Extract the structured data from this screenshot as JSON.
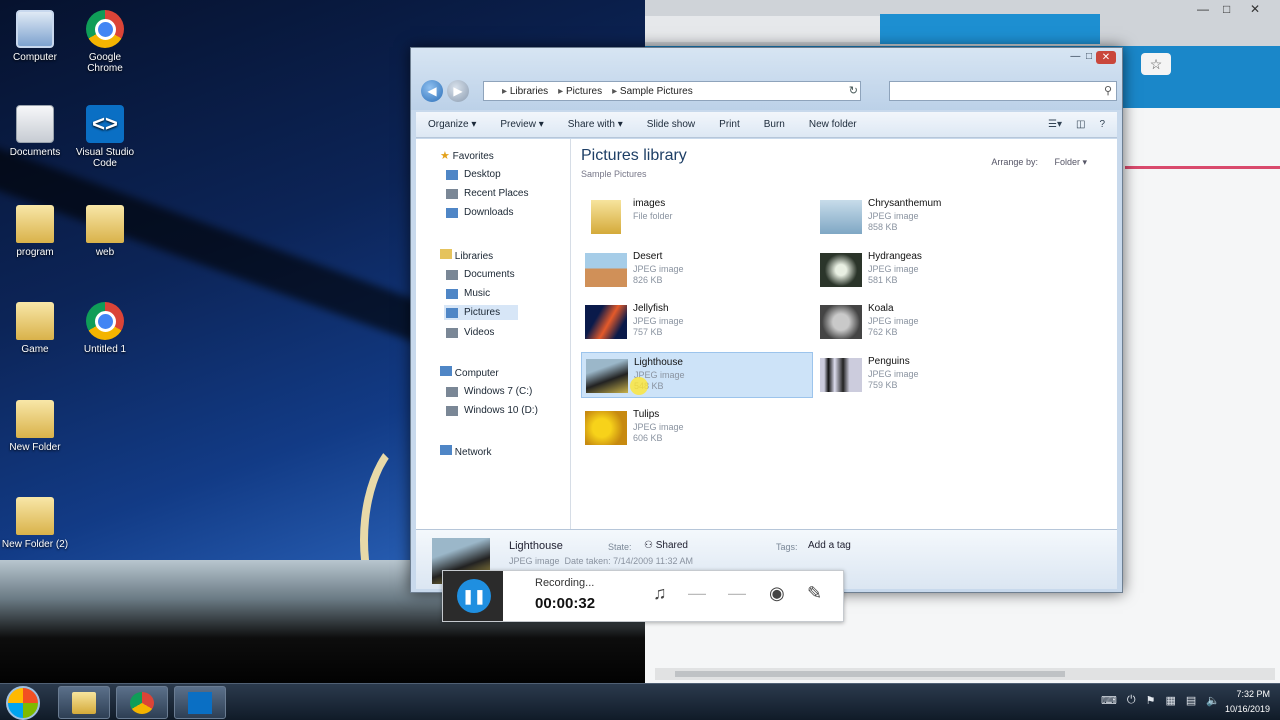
{
  "desktop": {
    "icons": [
      {
        "label": "Computer"
      },
      {
        "label": "Google Chrome"
      },
      {
        "label": "Documents"
      },
      {
        "label": "Visual Studio Code"
      },
      {
        "label": "program"
      },
      {
        "label": "web"
      },
      {
        "label": "Game"
      },
      {
        "label": "Untitled 1"
      },
      {
        "label": "New Folder"
      },
      {
        "label": "New Folder (2)"
      }
    ]
  },
  "explorer": {
    "breadcrumb": [
      "Libraries",
      "Pictures",
      "Sample Pictures"
    ],
    "search_placeholder": "",
    "toolbar": [
      "Organize ▾",
      "Preview ▾",
      "Share with ▾",
      "Slide show",
      "Print",
      "Burn",
      "New folder"
    ],
    "nav": {
      "favorites": "Favorites",
      "fav_items": [
        "Desktop",
        "Recent Places",
        "Downloads"
      ],
      "libraries": "Libraries",
      "lib_items": [
        "Documents",
        "Music",
        "Pictures",
        "Videos"
      ],
      "computer": "Computer",
      "comp_items": [
        "Windows 7 (C:)",
        "Windows 10 (D:)"
      ],
      "network": "Network"
    },
    "library_title": "Pictures library",
    "library_subtitle": "Sample Pictures",
    "arrange_label": "Arrange by:",
    "arrange_value": "Folder ▾",
    "files": [
      {
        "name": "images",
        "meta1": "File folder",
        "meta2": ""
      },
      {
        "name": "Chrysanthemum",
        "meta1": "JPEG image",
        "meta2": "858 KB"
      },
      {
        "name": "Desert",
        "meta1": "JPEG image",
        "meta2": "826 KB"
      },
      {
        "name": "Hydrangeas",
        "meta1": "JPEG image",
        "meta2": "581 KB"
      },
      {
        "name": "Jellyfish",
        "meta1": "JPEG image",
        "meta2": "757 KB"
      },
      {
        "name": "Koala",
        "meta1": "JPEG image",
        "meta2": "762 KB"
      },
      {
        "name": "Lighthouse",
        "meta1": "JPEG image",
        "meta2": "548 KB"
      },
      {
        "name": "Penguins",
        "meta1": "JPEG image",
        "meta2": "759 KB"
      },
      {
        "name": "Tulips",
        "meta1": "JPEG image",
        "meta2": "606 KB"
      }
    ],
    "details": {
      "name": "Lighthouse",
      "type": "JPEG image",
      "date_label": "Date taken:",
      "date_value": "7/14/2009 11:32 AM",
      "state_label": "State:",
      "state_value": "Shared",
      "tags_label": "Tags:",
      "tags_value": "Add a tag"
    }
  },
  "recorder": {
    "status": "Recording...",
    "timer": "00:00:32"
  },
  "taskbar": {
    "time": "7:32 PM",
    "date": "10/16/2019"
  }
}
